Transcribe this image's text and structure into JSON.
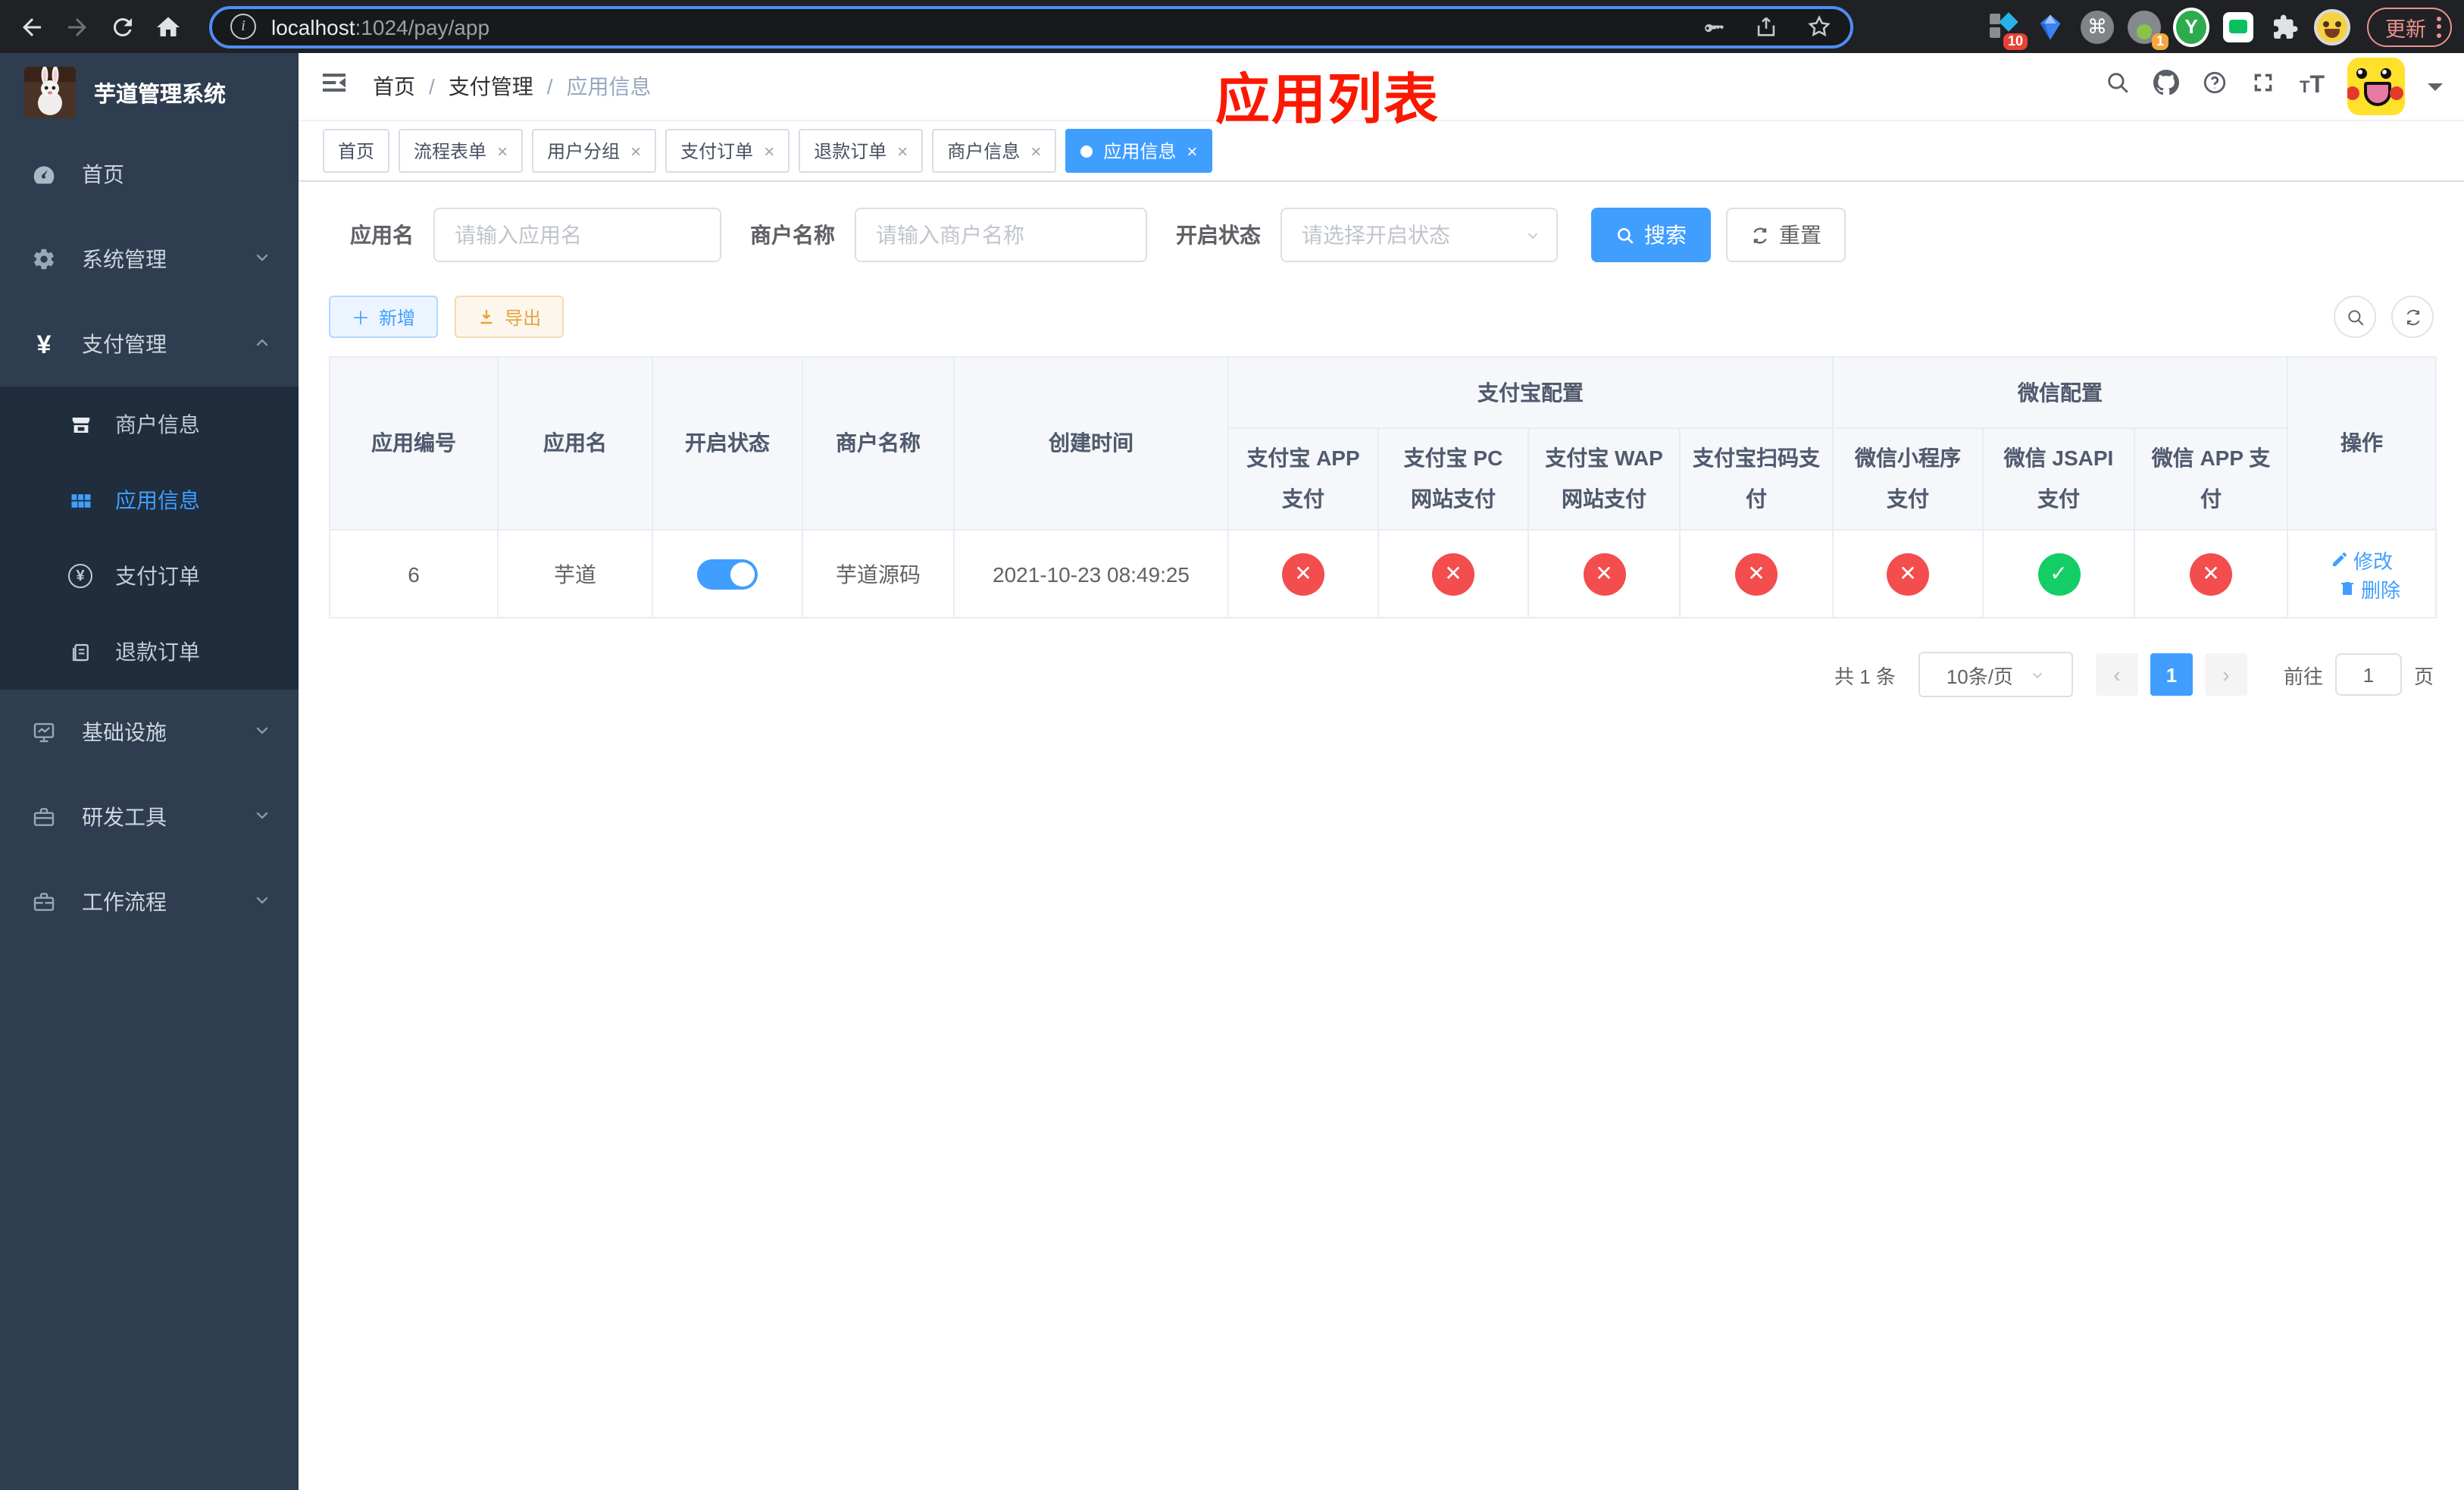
{
  "browser": {
    "url_host": "localhost",
    "url_rest": ":1024/pay/app",
    "update_label": "更新",
    "ext_badge_blue_diamond": "10",
    "ext_badge_green_dot": "1"
  },
  "icons": {
    "cmd": "⌘",
    "y_letter": "Y",
    "close": "×",
    "check": "✓",
    "cross": "✕",
    "yen": "¥",
    "plus": "＋",
    "question": "?",
    "info": "i",
    "prev": "‹",
    "next": "›",
    "slash": "/"
  },
  "sidebar": {
    "title": "芋道管理系统",
    "items": [
      {
        "label": "首页"
      },
      {
        "label": "系统管理"
      },
      {
        "label": "支付管理"
      },
      {
        "label": "商户信息"
      },
      {
        "label": "应用信息"
      },
      {
        "label": "支付订单"
      },
      {
        "label": "退款订单"
      },
      {
        "label": "基础设施"
      },
      {
        "label": "研发工具"
      },
      {
        "label": "工作流程"
      }
    ]
  },
  "breadcrumb": {
    "items": [
      "首页",
      "支付管理",
      "应用信息"
    ]
  },
  "overlay_title": "应用列表",
  "tabs": [
    {
      "label": "首页",
      "closable": false,
      "active": false
    },
    {
      "label": "流程表单",
      "closable": true,
      "active": false
    },
    {
      "label": "用户分组",
      "closable": true,
      "active": false
    },
    {
      "label": "支付订单",
      "closable": true,
      "active": false
    },
    {
      "label": "退款订单",
      "closable": true,
      "active": false
    },
    {
      "label": "商户信息",
      "closable": true,
      "active": false
    },
    {
      "label": "应用信息",
      "closable": true,
      "active": true
    }
  ],
  "filters": {
    "app_name_label": "应用名",
    "app_name_placeholder": "请输入应用名",
    "merchant_label": "商户名称",
    "merchant_placeholder": "请输入商户名称",
    "status_label": "开启状态",
    "status_placeholder": "请选择开启状态",
    "search_label": "搜索",
    "reset_label": "重置"
  },
  "actions": {
    "add_label": "新增",
    "export_label": "导出"
  },
  "table": {
    "headers": {
      "app_id": "应用编号",
      "app_name": "应用名",
      "status": "开启状态",
      "merchant": "商户名称",
      "created": "创建时间",
      "alipay_group": "支付宝配置",
      "wechat_group": "微信配置",
      "ops": "操作",
      "sub": [
        "支付宝 APP 支付",
        "支付宝 PC 网站支付",
        "支付宝 WAP 网站支付",
        "支付宝扫码支付",
        "微信小程序支付",
        "微信 JSAPI 支付",
        "微信 APP 支付"
      ]
    },
    "row": {
      "app_id": "6",
      "app_name": "芋道",
      "enabled": true,
      "merchant": "芋道源码",
      "created": "2021-10-23 08:49:25",
      "channel_enabled": [
        false,
        false,
        false,
        false,
        false,
        true,
        false
      ],
      "edit_label": "修改",
      "delete_label": "删除"
    }
  },
  "pagination": {
    "total": "共 1 条",
    "page_size": "10条/页",
    "current": "1",
    "goto_label": "前往",
    "goto_value": "1",
    "page_suffix": "页"
  },
  "colors": {
    "accent": "#409eff",
    "tag_active": "#409eff",
    "danger_circle": "#f34d4d",
    "success_circle": "#13ce66",
    "overlay_title": "#fb1800",
    "sidebar_bg": "#2e3d4f",
    "submenu_bg": "#1f2d3d"
  }
}
